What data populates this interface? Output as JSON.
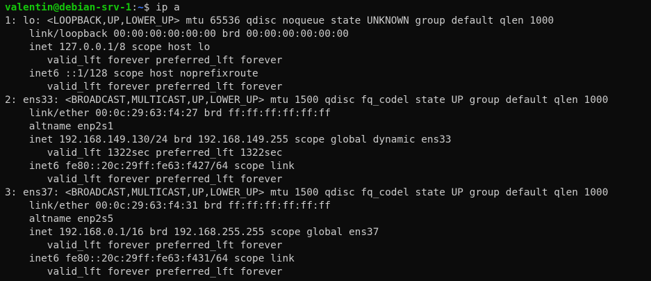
{
  "prompt": {
    "user_host": "valentin@debian-srv-1",
    "separator": ":",
    "path": "~",
    "symbol": "$",
    "command": " ip a"
  },
  "output": [
    "1: lo: <LOOPBACK,UP,LOWER_UP> mtu 65536 qdisc noqueue state UNKNOWN group default qlen 1000",
    "    link/loopback 00:00:00:00:00:00 brd 00:00:00:00:00:00",
    "    inet 127.0.0.1/8 scope host lo",
    "       valid_lft forever preferred_lft forever",
    "    inet6 ::1/128 scope host noprefixroute",
    "       valid_lft forever preferred_lft forever",
    "2: ens33: <BROADCAST,MULTICAST,UP,LOWER_UP> mtu 1500 qdisc fq_codel state UP group default qlen 1000",
    "    link/ether 00:0c:29:63:f4:27 brd ff:ff:ff:ff:ff:ff",
    "    altname enp2s1",
    "    inet 192.168.149.130/24 brd 192.168.149.255 scope global dynamic ens33",
    "       valid_lft 1322sec preferred_lft 1322sec",
    "    inet6 fe80::20c:29ff:fe63:f427/64 scope link",
    "       valid_lft forever preferred_lft forever",
    "3: ens37: <BROADCAST,MULTICAST,UP,LOWER_UP> mtu 1500 qdisc fq_codel state UP group default qlen 1000",
    "    link/ether 00:0c:29:63:f4:31 brd ff:ff:ff:ff:ff:ff",
    "    altname enp2s5",
    "    inet 192.168.0.1/16 brd 192.168.255.255 scope global ens37",
    "       valid_lft forever preferred_lft forever",
    "    inet6 fe80::20c:29ff:fe63:f431/64 scope link",
    "       valid_lft forever preferred_lft forever"
  ],
  "colors": {
    "background": "#0c0c0c",
    "text": "#cccccc",
    "user_host": "#16c60c",
    "path": "#3b78ff"
  }
}
